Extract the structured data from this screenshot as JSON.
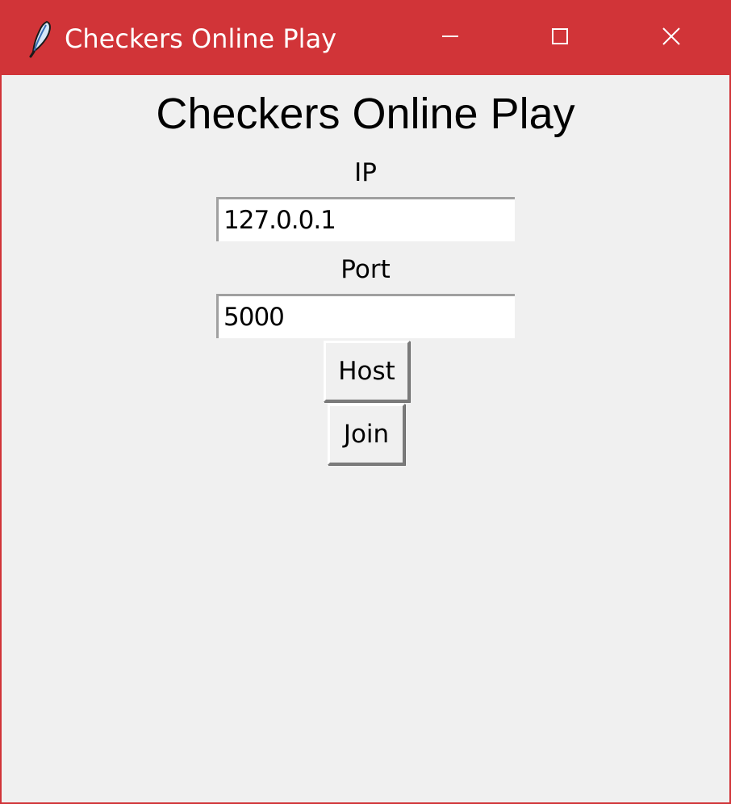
{
  "window": {
    "title": "Checkers Online Play",
    "app_icon": "feather-icon",
    "controls": {
      "minimize_icon": "minimize-icon",
      "maximize_icon": "maximize-icon",
      "close_icon": "close-icon"
    },
    "accent_color": "#d13438",
    "background_color": "#f0f0f0"
  },
  "form": {
    "heading": "Checkers Online Play",
    "ip_label": "IP",
    "ip_value": "127.0.0.1",
    "port_label": "Port",
    "port_value": "5000",
    "host_button": "Host",
    "join_button": "Join"
  }
}
